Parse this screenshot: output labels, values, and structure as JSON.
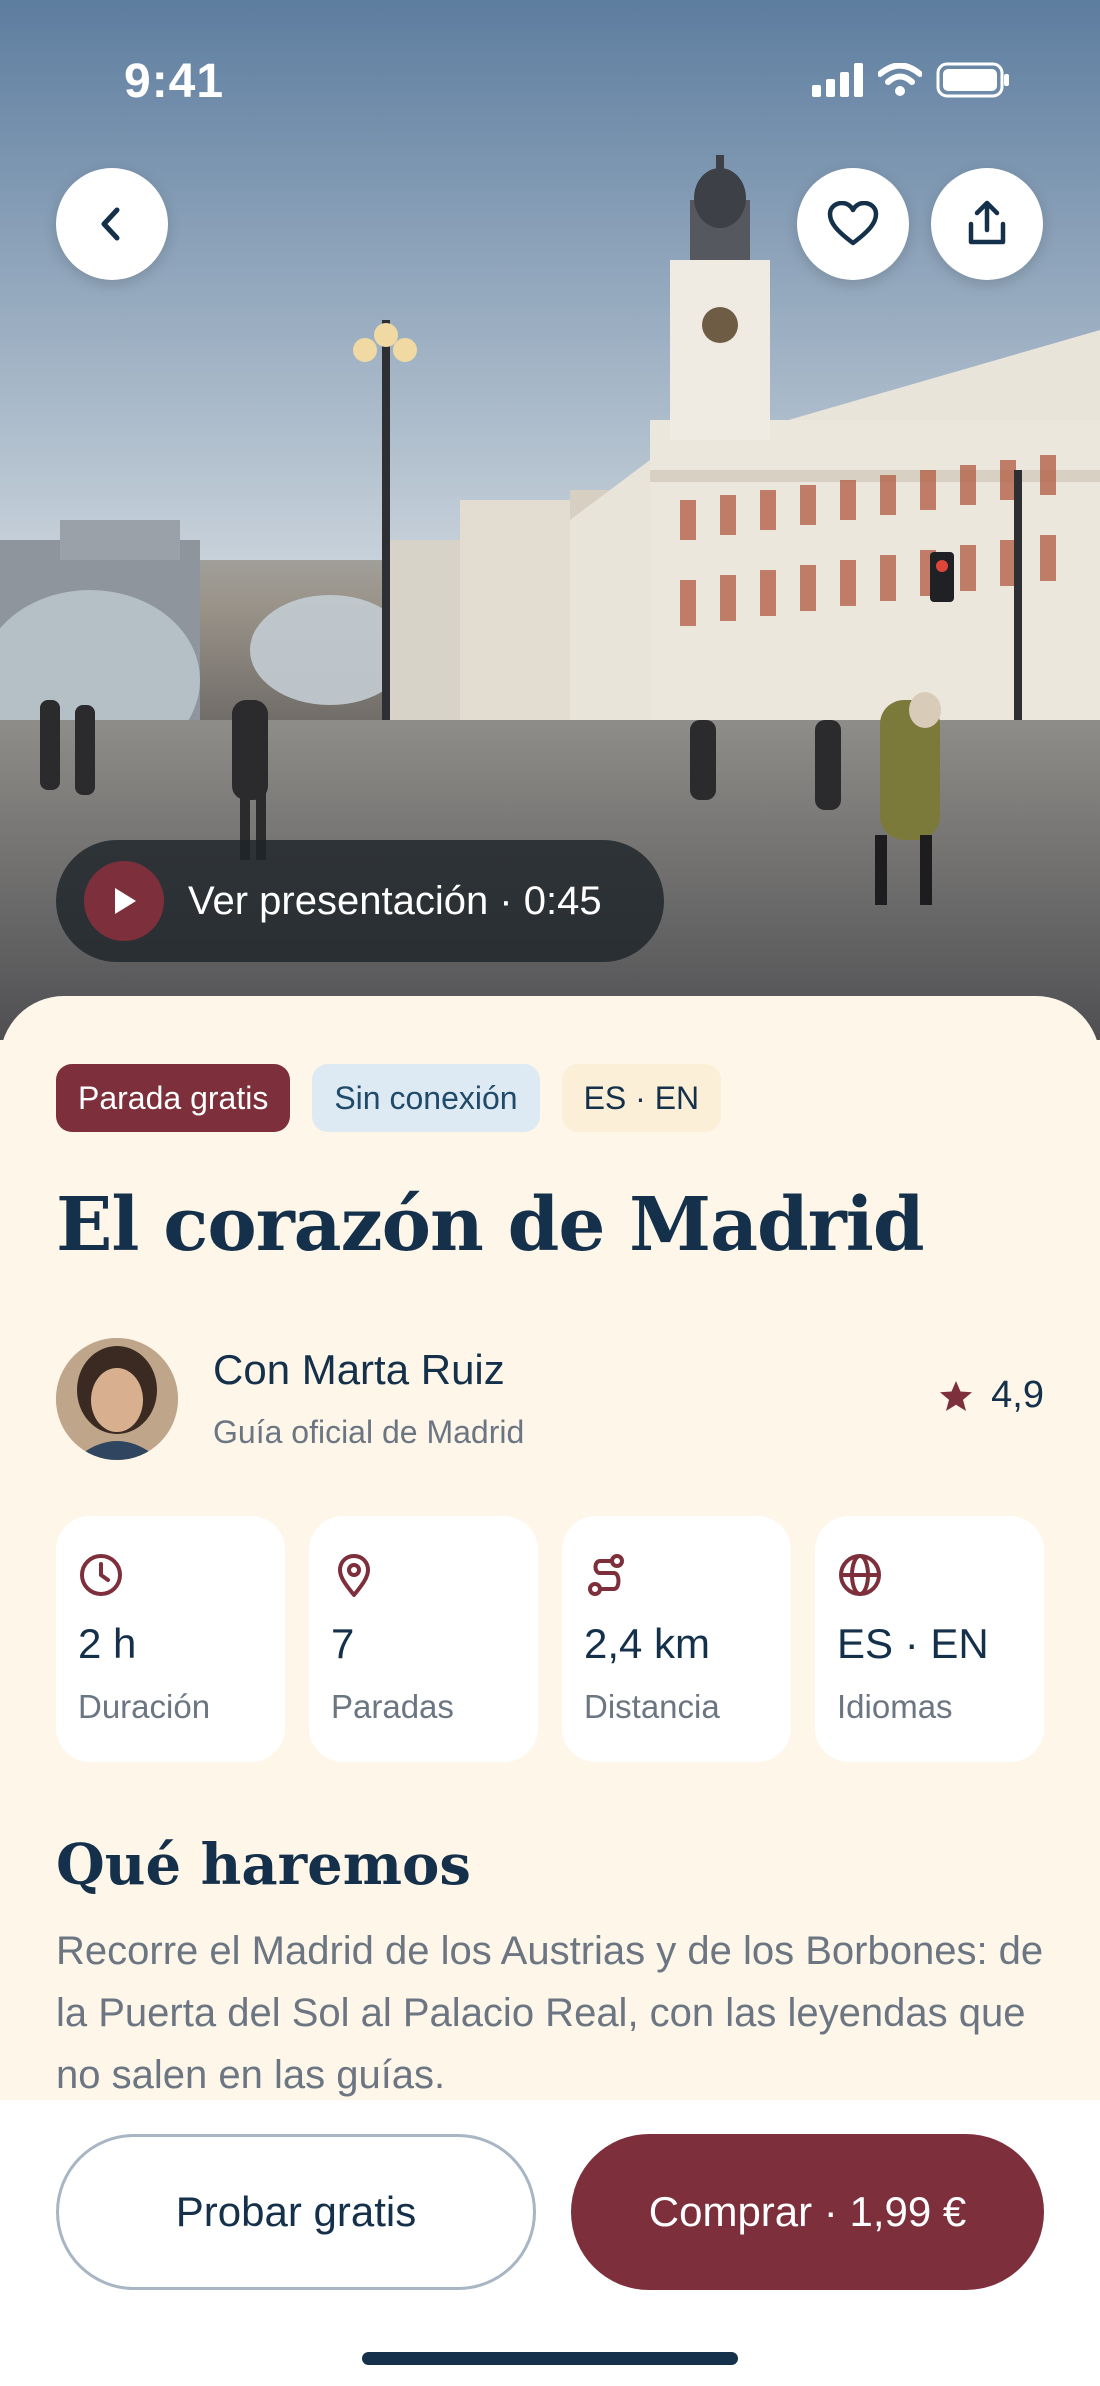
{
  "status_bar": {
    "time": "9:41"
  },
  "hero": {
    "video_label": "Ver presentación · 0:45"
  },
  "tags": [
    "Parada gratis",
    "Sin conexión",
    "ES · EN"
  ],
  "tour": {
    "title": "El corazón de Madrid"
  },
  "guide": {
    "name": "Con Marta Ruiz",
    "role": "Guía oficial de Madrid",
    "rating": "4,9"
  },
  "stats": [
    {
      "icon": "clock-icon",
      "value": "2 h",
      "label": "Duración"
    },
    {
      "icon": "map-pin-icon",
      "value": "7",
      "label": "Paradas"
    },
    {
      "icon": "route-icon",
      "value": "2,4 km",
      "label": "Distancia"
    },
    {
      "icon": "globe-icon",
      "value": "ES · EN",
      "label": "Idiomas"
    }
  ],
  "about": {
    "title": "Qué haremos",
    "text": "Recorre el Madrid de los Austrias y de los Borbones: de la Puerta del Sol al Palacio Real, con las leyendas que no salen en las guías."
  },
  "actions": {
    "try_label": "Probar gratis",
    "buy_label": "Comprar · 1,99 €"
  },
  "colors": {
    "accent": "#7d2f3b",
    "navy": "#14304a",
    "sheet_bg": "#fdf6e9",
    "muted": "#6b7682"
  }
}
